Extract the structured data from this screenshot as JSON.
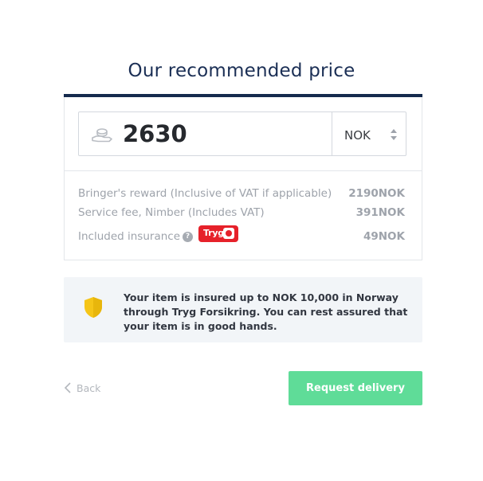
{
  "header": {
    "title": "Our recommended price"
  },
  "price": {
    "value": "2630",
    "currency": "NOK",
    "icon": "hand-coin-icon"
  },
  "breakdown": [
    {
      "label": "Bringer's reward (Inclusive of VAT if applicable)",
      "amount": "2190NOK"
    },
    {
      "label": "Service fee, Nimber (Includes VAT)",
      "amount": "391NOK"
    },
    {
      "label": "Included insurance",
      "amount": "49NOK"
    }
  ],
  "insurance": {
    "help_icon": "question-circle-icon",
    "partner_logo_text": "Tryg",
    "info_text": "Your item is insured up to NOK 10,000 in Norway through Tryg Forsikring. You can rest assured that your item is in good hands.",
    "shield_icon": "shield-icon"
  },
  "actions": {
    "back_label": "Back",
    "request_label": "Request delivery"
  },
  "colors": {
    "accent_bar": "#152a4d",
    "primary_button": "#5fdc98",
    "shield": "#f5c518",
    "tryg_red": "#e6212a",
    "info_background": "#f2f5f8"
  }
}
